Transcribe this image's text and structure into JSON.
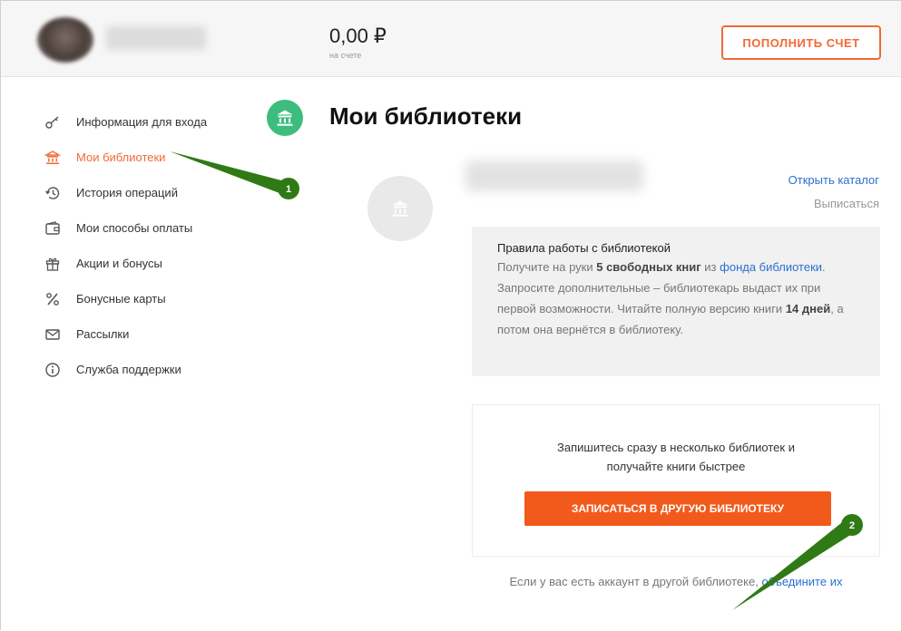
{
  "header": {
    "balance": "0,00 ₽",
    "balance_caption": "на счете",
    "topup_label": "ПОПОЛНИТЬ СЧЕТ"
  },
  "sidebar": {
    "items": [
      {
        "label": "Информация для входа",
        "icon": "key-icon"
      },
      {
        "label": "Мои библиотеки",
        "icon": "library-icon"
      },
      {
        "label": "История операций",
        "icon": "history-icon"
      },
      {
        "label": "Мои способы оплаты",
        "icon": "wallet-icon"
      },
      {
        "label": "Акции и бонусы",
        "icon": "gift-icon"
      },
      {
        "label": "Бонусные карты",
        "icon": "percent-icon"
      },
      {
        "label": "Рассылки",
        "icon": "mail-icon"
      },
      {
        "label": "Служба поддержки",
        "icon": "info-icon"
      }
    ]
  },
  "main": {
    "title": "Мои библиотеки",
    "library": {
      "open_catalog": "Открыть каталог",
      "unsubscribe": "Выписаться"
    },
    "rules": {
      "title": "Правила работы с библиотекой",
      "p1": "Получите на руки ",
      "p1_bold": "5 свободных книг",
      "p1_mid": " из ",
      "p1_link": "фонда библиотеки",
      "p1_end": ". Запросите дополнительные – библиотекарь выдаст их при первой возможности. Читайте полную версию книги ",
      "p1_bold2": "14 дней",
      "p1_tail": ", а потом она вернётся в библиотеку."
    },
    "join": {
      "text": "Запишитесь сразу в несколько библиотек и получайте книги быстрее",
      "button": "ЗАПИСАТЬСЯ В ДРУГУЮ БИБЛИОТЕКУ"
    },
    "merge": {
      "text": "Если у вас есть аккаунт в другой библиотеке, ",
      "link": "объедините их"
    }
  },
  "annotations": [
    "1",
    "2"
  ],
  "colors": {
    "accent": "#f06a35",
    "button": "#f25a1c",
    "link": "#2a6fd1",
    "badge": "#3dbd7d",
    "annotation": "#2f7a14"
  }
}
